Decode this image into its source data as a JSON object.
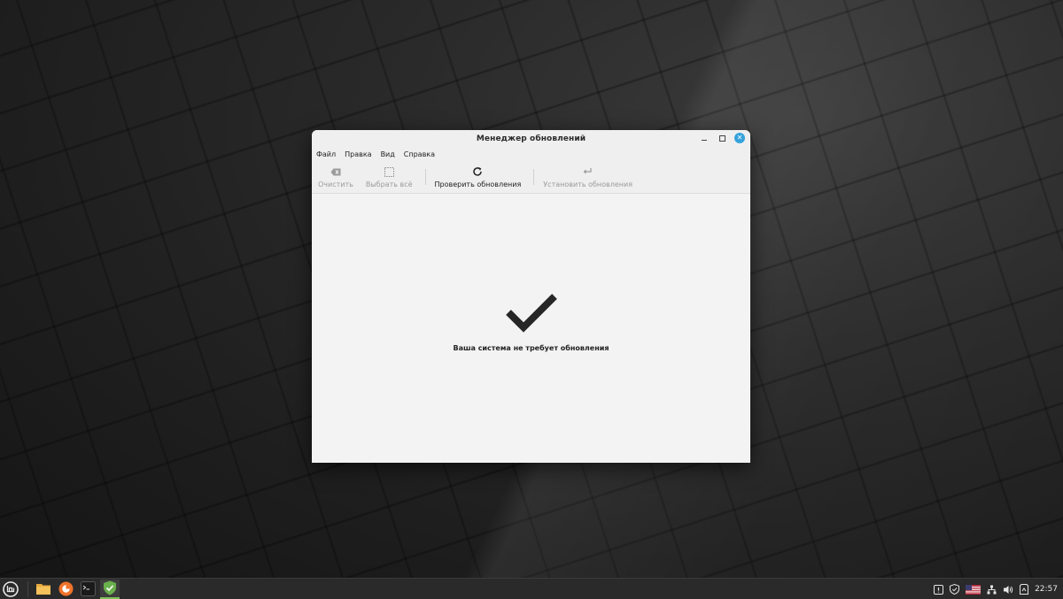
{
  "window": {
    "title": "Менеджер обновлений"
  },
  "menubar": {
    "items": [
      "Файл",
      "Правка",
      "Вид",
      "Справка"
    ]
  },
  "toolbar": {
    "clear_label": "Очистить",
    "select_all_label": "Выбрать всё",
    "check_updates_label": "Проверить обновления",
    "install_updates_label": "Установить обновления"
  },
  "main": {
    "status_message": "Ваша система не требует обновления"
  },
  "taskbar": {
    "clock": "22:57",
    "accent_color": "#7fc25a"
  },
  "colors": {
    "close_button": "#35a2db",
    "mint_green": "#6ab04c"
  },
  "icons": {
    "status": "checkmark-icon",
    "clear": "backspace-icon",
    "select_all": "selection-icon",
    "refresh": "refresh-icon",
    "install": "enter-icon"
  }
}
